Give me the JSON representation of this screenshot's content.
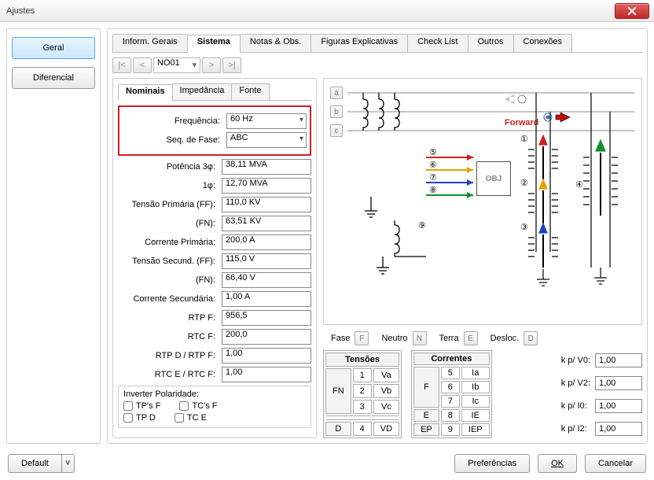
{
  "window": {
    "title": "Ajustes"
  },
  "sidebar": {
    "geral": "Geral",
    "diferencial": "Diferencial"
  },
  "nav": {
    "selected": "NO01"
  },
  "tabs": {
    "inform": "Inform. Gerais",
    "sistema": "Sistema",
    "notas": "Notas & Obs.",
    "figuras": "Figuras Explicativas",
    "checklist": "Check List",
    "outros": "Outros",
    "conexoes": "Conexões"
  },
  "subtabs": {
    "nominais": "Nominais",
    "impedancia": "Impedância",
    "fonte": "Fonte"
  },
  "form": {
    "frequencia_label": "Frequência:",
    "frequencia": "60 Hz",
    "seqfase_label": "Seq. de Fase:",
    "seqfase": "ABC",
    "pot3_label": "Potência 3φ:",
    "pot3": "38,11 MVA",
    "pot1_label": "1φ:",
    "pot1": "12,70 MVA",
    "tpff_label": "Tensão Primária (FF):",
    "tpff": "110,0 KV",
    "tpfn_label": "(FN):",
    "tpfn": "63,51 KV",
    "corrprim_label": "Corrente Primária:",
    "corrprim": "200,0 A",
    "tsff_label": "Tensão Secund. (FF):",
    "tsff": "115,0 V",
    "tsfn_label": "(FN):",
    "tsfn": "66,40 V",
    "corrsec_label": "Corrente Secundária:",
    "corrsec": "1,00 A",
    "rtpf_label": "RTP F:",
    "rtpf": "956,5",
    "rtcf_label": "RTC F:",
    "rtcf": "200,0",
    "rtpd_label": "RTP D / RTP F:",
    "rtpd": "1,00",
    "rtce_label": "RTC E / RTC F:",
    "rtce": "1,00"
  },
  "polarity": {
    "title": "Inverter Polaridade:",
    "tpsf": "TP's F",
    "tcsf": "TC's F",
    "tpd": "TP D",
    "tce": "TC E"
  },
  "diagram": {
    "btn_a": "a",
    "btn_b": "b",
    "btn_c": "c",
    "forward": "Forward",
    "obj": "OBJ"
  },
  "legend": {
    "fase": "Fase",
    "fase_k": "F",
    "neutro": "Neutro",
    "neutro_k": "N",
    "terra": "Terra",
    "terra_k": "E",
    "desloc": "Desloc.",
    "desloc_k": "D"
  },
  "tensoes": {
    "title": "Tensões",
    "side1": "FN",
    "r1n": "1",
    "r1": "Va",
    "r2n": "2",
    "r2": "Vb",
    "r3n": "3",
    "r3": "Vc",
    "side2": "D",
    "r4n": "4",
    "r4": "VD"
  },
  "correntes": {
    "title": "Correntes",
    "side1": "F",
    "r1n": "5",
    "r1": "Ia",
    "r2n": "6",
    "r2": "Ib",
    "r3n": "7",
    "r3": "Ic",
    "side2": "E",
    "r4n": "8",
    "r4": "IE",
    "side3": "EP",
    "r5n": "9",
    "r5": "IEP"
  },
  "kp": {
    "v0_label": "k p/ V0:",
    "v0": "1,00",
    "v2_label": "k p/ V2:",
    "v2": "1,00",
    "i0_label": "k p/ I0:",
    "i0": "1,00",
    "i2_label": "k p/ I2:",
    "i2": "1,00"
  },
  "footer": {
    "default": "Default",
    "prefer": "Preferências",
    "ok": "OK",
    "cancel": "Cancelar"
  }
}
